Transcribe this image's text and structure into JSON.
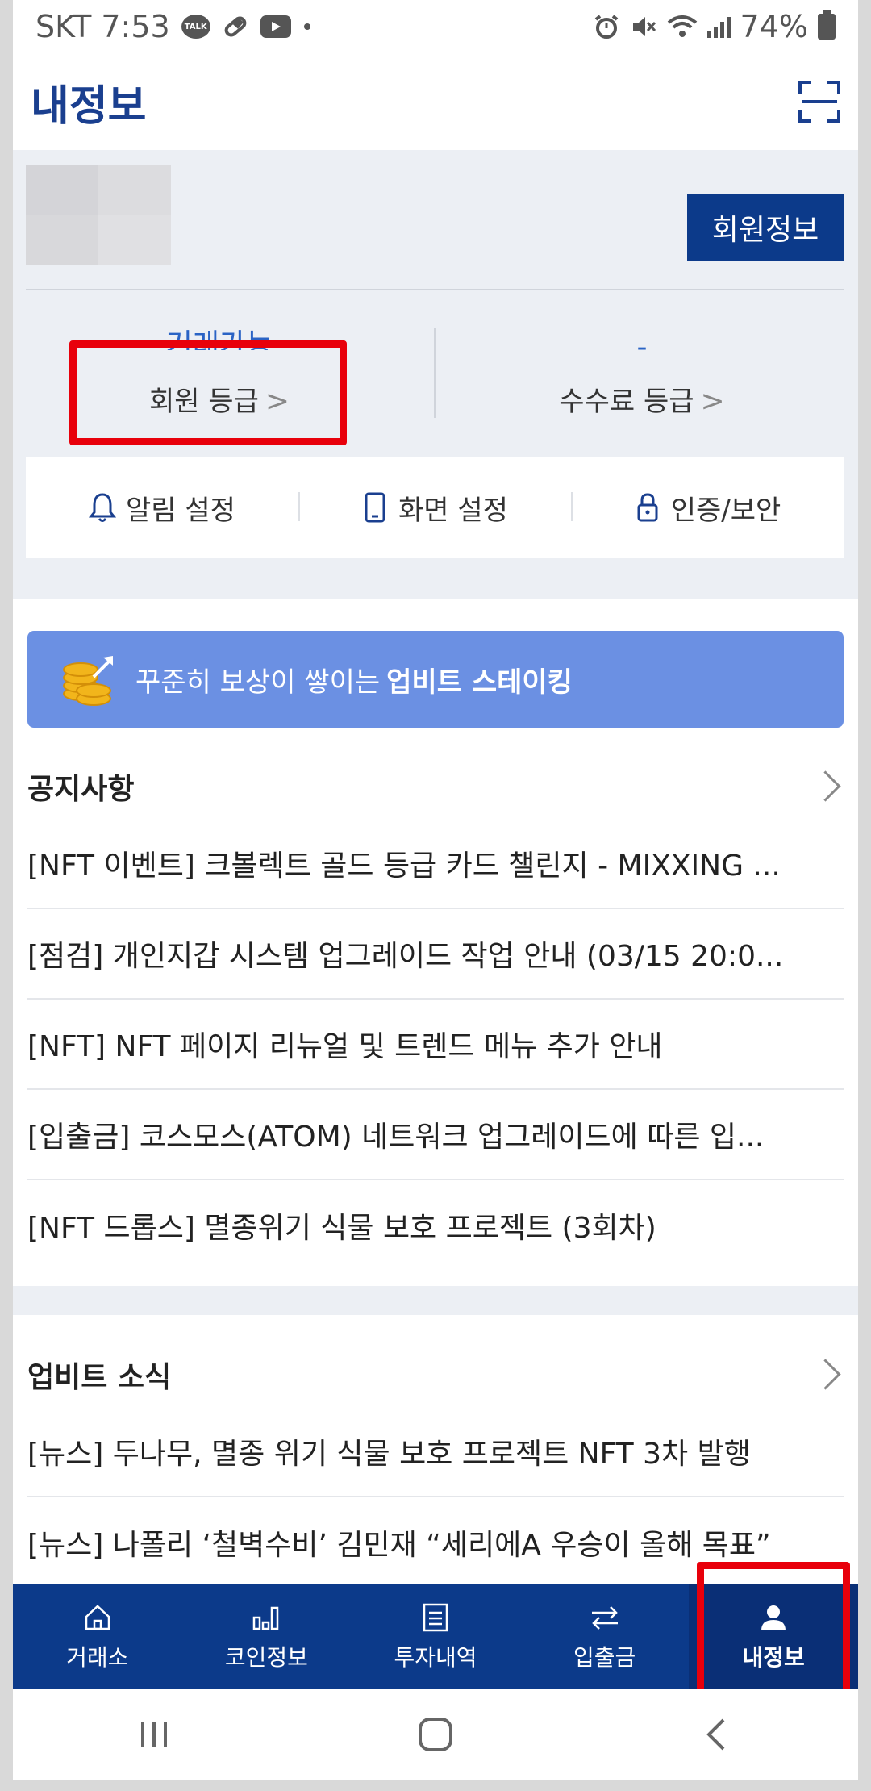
{
  "status_bar": {
    "carrier_time": "SKT 7:53",
    "talk_badge": "TALK",
    "battery": "74%",
    "icons": [
      "talk-icon",
      "pill-icon",
      "youtube-icon",
      "dot-icon",
      "alarm-icon",
      "mute-icon",
      "wifi-icon",
      "signal-icon",
      "battery-icon"
    ]
  },
  "header": {
    "title": "내정보",
    "scan_icon": "scan-icon"
  },
  "profile": {
    "member_info_button": "회원정보",
    "member_grade": {
      "value": "거래가능",
      "label": "회원 등급"
    },
    "fee_grade": {
      "value": "-",
      "label": "수수료 등급"
    },
    "settings": [
      {
        "label": "알림 설정",
        "icon": "bell-icon"
      },
      {
        "label": "화면 설정",
        "icon": "phone-icon"
      },
      {
        "label": "인증/보안",
        "icon": "lock-icon"
      }
    ]
  },
  "staking_banner": {
    "text": "꾸준히 보상이 쌓이는",
    "strong": "업비트 스테이킹"
  },
  "notices": {
    "title": "공지사항",
    "items": [
      "[NFT 이벤트] 크볼렉트 골드 등급 카드 챌린지 - MIXXING ...",
      "[점검] 개인지갑 시스템 업그레이드 작업 안내 (03/15 20:0...",
      "[NFT] NFT 페이지 리뉴얼 및 트렌드 메뉴 추가 안내",
      "[입출금] 코스모스(ATOM) 네트워크 업그레이드에 따른 입...",
      "[NFT 드롭스] 멸종위기 식물 보호 프로젝트 (3회차)"
    ]
  },
  "news": {
    "title": "업비트 소식",
    "items": [
      "[뉴스] 두나무, 멸종 위기 식물 보호 프로젝트 NFT 3차 발행",
      "[뉴스] 나폴리 ‘철벽수비’ 김민재 “세리에A 우승이 올해 목표”"
    ]
  },
  "bottom_nav": [
    {
      "label": "거래소",
      "icon": "home-icon",
      "active": false
    },
    {
      "label": "코인정보",
      "icon": "bar-chart-icon",
      "active": false
    },
    {
      "label": "투자내역",
      "icon": "document-icon",
      "active": false
    },
    {
      "label": "입출금",
      "icon": "transfer-icon",
      "active": false
    },
    {
      "label": "내정보",
      "icon": "person-icon",
      "active": true
    }
  ],
  "colors": {
    "brand": "#0c3a8a",
    "banner": "#6b90e3",
    "highlight": "#e8000b",
    "grade_value": "#2a63c5"
  }
}
